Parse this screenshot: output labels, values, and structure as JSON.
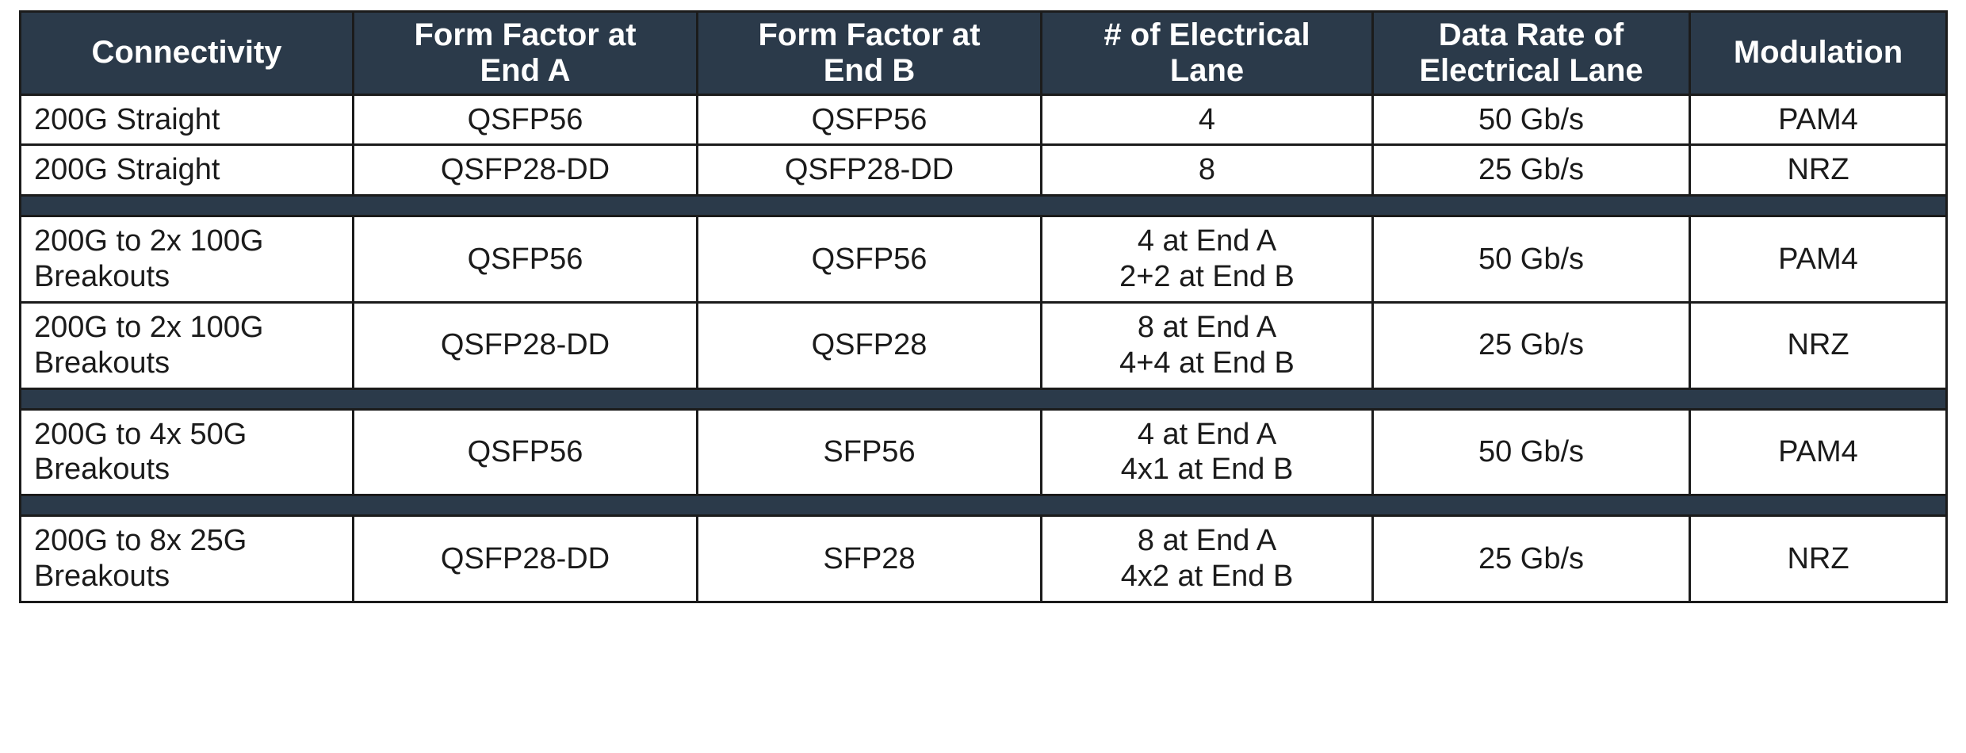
{
  "table": {
    "headers": [
      "Connectivity",
      "Form Factor at End A",
      "Form Factor at End B",
      "# of Electrical Lane",
      "Data Rate of Electrical Lane",
      "Modulation"
    ],
    "header_lines": [
      [
        "Connectivity"
      ],
      [
        "Form Factor at",
        "End A"
      ],
      [
        "Form Factor at",
        "End B"
      ],
      [
        "# of Electrical",
        "Lane"
      ],
      [
        "Data Rate of",
        "Electrical Lane"
      ],
      [
        "Modulation"
      ]
    ],
    "colors": {
      "header_background": "#2b3a4a",
      "header_text": "#ffffff",
      "body_background": "#ffffff",
      "body_text": "#1b1b1b",
      "border": "#1b1b1b",
      "spacer_band": "#2b3a4a"
    },
    "groups": [
      {
        "name": "200G Straight",
        "rows": [
          {
            "connectivity": [
              "200G Straight"
            ],
            "form_factor_end_a": [
              "QSFP56"
            ],
            "form_factor_end_b": [
              "QSFP56"
            ],
            "electrical_lanes": [
              "4"
            ],
            "data_rate": [
              "50 Gb/s"
            ],
            "modulation": [
              "PAM4"
            ]
          },
          {
            "connectivity": [
              "200G Straight"
            ],
            "form_factor_end_a": [
              "QSFP28-DD"
            ],
            "form_factor_end_b": [
              "QSFP28-DD"
            ],
            "electrical_lanes": [
              "8"
            ],
            "data_rate": [
              "25 Gb/s"
            ],
            "modulation": [
              "NRZ"
            ]
          }
        ]
      },
      {
        "name": "200G to 2x 100G Breakouts",
        "rows": [
          {
            "connectivity": [
              "200G to 2x 100G",
              "Breakouts"
            ],
            "form_factor_end_a": [
              "QSFP56"
            ],
            "form_factor_end_b": [
              "QSFP56"
            ],
            "electrical_lanes": [
              "4 at End A",
              "2+2 at End B"
            ],
            "data_rate": [
              "50 Gb/s"
            ],
            "modulation": [
              "PAM4"
            ]
          },
          {
            "connectivity": [
              "200G to 2x 100G",
              "Breakouts"
            ],
            "form_factor_end_a": [
              "QSFP28-DD"
            ],
            "form_factor_end_b": [
              "QSFP28"
            ],
            "electrical_lanes": [
              "8 at End A",
              "4+4 at End B"
            ],
            "data_rate": [
              "25 Gb/s"
            ],
            "modulation": [
              "NRZ"
            ]
          }
        ]
      },
      {
        "name": "200G to 4x 50G Breakouts",
        "rows": [
          {
            "connectivity": [
              "200G to 4x 50G",
              "Breakouts"
            ],
            "form_factor_end_a": [
              "QSFP56"
            ],
            "form_factor_end_b": [
              "SFP56"
            ],
            "electrical_lanes": [
              "4 at End A",
              "4x1 at End B"
            ],
            "data_rate": [
              "50 Gb/s"
            ],
            "modulation": [
              "PAM4"
            ]
          }
        ]
      },
      {
        "name": "200G to 8x 25G Breakouts",
        "rows": [
          {
            "connectivity": [
              "200G to 8x 25G",
              "Breakouts"
            ],
            "form_factor_end_a": [
              "QSFP28-DD"
            ],
            "form_factor_end_b": [
              "SFP28"
            ],
            "electrical_lanes": [
              "8 at End A",
              "4x2 at End B"
            ],
            "data_rate": [
              "25 Gb/s"
            ],
            "modulation": [
              "NRZ"
            ]
          }
        ]
      }
    ]
  }
}
